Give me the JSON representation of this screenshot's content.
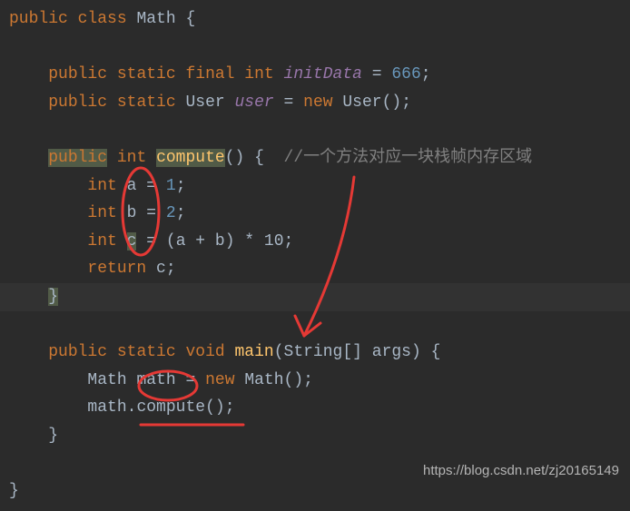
{
  "code": {
    "class_decl": {
      "kw_public": "public",
      "kw_class": "class",
      "name": "Math",
      "brace": "{"
    },
    "field1": {
      "kw1": "public",
      "kw2": "static",
      "kw3": "final",
      "type": "int",
      "name": "initData",
      "eq": "=",
      "val": "666",
      "semi": ";"
    },
    "field2": {
      "kw1": "public",
      "kw2": "static",
      "type": "User",
      "name": "user",
      "eq": "=",
      "newkw": "new",
      "ctor": "User",
      "parens": "()",
      "semi": ";"
    },
    "compute_decl": {
      "kw1": "public",
      "type": "int",
      "name": "compute",
      "parens": "()",
      "brace": "{",
      "comment": "//一个方法对应一块栈帧内存区域"
    },
    "l_a": {
      "type": "int",
      "var": "a",
      "eq": "=",
      "val": "1",
      "semi": ";"
    },
    "l_b": {
      "type": "int",
      "var": "b",
      "eq": "=",
      "val": "2",
      "semi": ";"
    },
    "l_c": {
      "type": "int",
      "var": "c",
      "eq": "=",
      "expr": "(a + b) * 10",
      "semi": ";"
    },
    "l_ret": {
      "kw": "return",
      "var": "c",
      "semi": ";"
    },
    "close1": "}",
    "main_decl": {
      "kw1": "public",
      "kw2": "static",
      "type": "void",
      "name": "main",
      "lp": "(",
      "ptype": "String[]",
      "pname": "args",
      "rp": ")",
      "brace": "{"
    },
    "l_math": {
      "type": "Math",
      "var": "math",
      "eq": "=",
      "newkw": "new",
      "ctor": "Math",
      "parens": "()",
      "semi": ";"
    },
    "l_call": {
      "obj": "math",
      "dot": ".",
      "method": "compute",
      "parens": "()",
      "semi": ";"
    },
    "close2": "}",
    "close3": "}"
  },
  "annotation_color": "#e53935",
  "watermark": "https://blog.csdn.net/zj20165149"
}
